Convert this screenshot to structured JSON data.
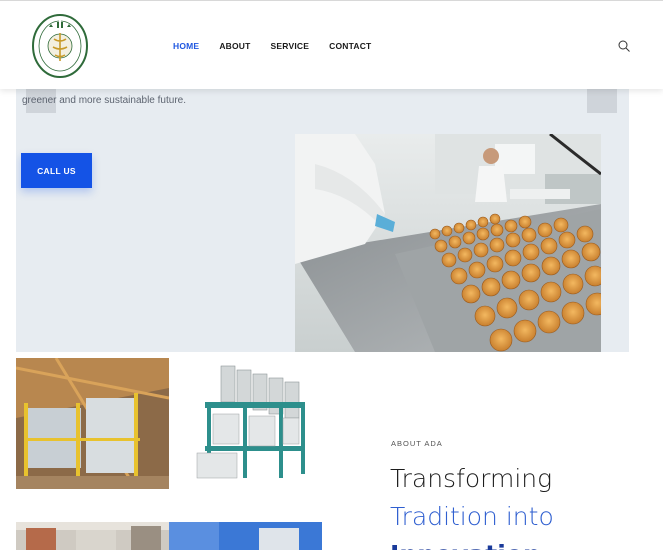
{
  "header": {
    "logo_text": "ADA",
    "nav": [
      {
        "label": "HOME",
        "active": true
      },
      {
        "label": "ABOUT",
        "active": false
      },
      {
        "label": "SERVICE",
        "active": false
      },
      {
        "label": "CONTACT",
        "active": false
      }
    ],
    "search_icon": "search-icon"
  },
  "hero": {
    "text_fragment": "greener and more sustainable future.",
    "call_button": "CALL US"
  },
  "about": {
    "eyebrow": "ABOUT ADA",
    "title_line1": "Transforming",
    "title_line2": "Tradition into",
    "title_line3": "Innovation"
  },
  "colors": {
    "accent": "#1453e6",
    "nav_active": "#1f57e0",
    "hero_bg": "#e7ecf1"
  }
}
